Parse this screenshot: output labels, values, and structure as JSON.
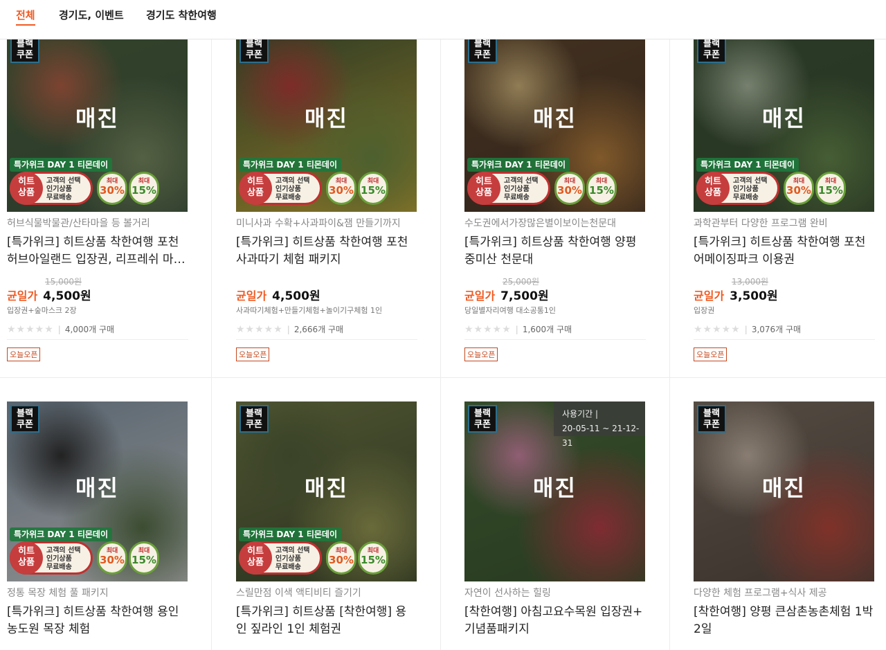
{
  "tabs": [
    "전체",
    "경기도, 이벤트",
    "경기도 착한여행"
  ],
  "soldout_label": "매진",
  "black_coupon_label": [
    "블랙",
    "쿠폰"
  ],
  "banner": {
    "day_label": "특가위크 DAY 1 티몬데이",
    "hit_circle": [
      "히트",
      "상품"
    ],
    "hit_text": [
      "고객의 선택",
      "인기상품",
      "무료배송"
    ],
    "disc1_top": "최대",
    "disc1_val": "30%",
    "disc2_top": "최대",
    "disc2_val": "15%"
  },
  "price_label": "균일가",
  "open_badge": "오늘오픈",
  "star_glyphs": "★★★★★",
  "products": [
    {
      "subtitle": "허브식물박물관/산타마을 등 볼거리",
      "title_lines": [
        "[특가위크] 히트상품 착한여행 포천",
        "허브아일랜드 입장권, 리프레쉬 마…"
      ],
      "original_price": "15,000원",
      "price": "4,500원",
      "option": "입장권+숲마스크 2장",
      "purchases": "4,000개 구매",
      "has_banner": true,
      "colors": [
        "#3d5a2c",
        "#7a8f5a",
        "#c35a3a",
        "#2f4a30"
      ]
    },
    {
      "subtitle": "미니사과 수확+사과파이&잼 만들기까지",
      "title_lines": [
        "[특가위크] 히트상품 착한여행 포천",
        "사과따기 체험 패키지"
      ],
      "original_price": "",
      "price": "4,500원",
      "option": "사과따기체험+만들기체험+놀이기구체험 1인",
      "purchases": "2,666개 구매",
      "has_banner": true,
      "colors": [
        "#2e4a22",
        "#6b8f35",
        "#c4302a",
        "#d9b227"
      ]
    },
    {
      "subtitle": "수도권에서가장많은별이보이는천문대",
      "title_lines": [
        "[특가위크] 히트상품 착한여행 양평",
        "중미산 천문대"
      ],
      "original_price": "25,000원",
      "price": "7,500원",
      "option": "당일별자리여행 대소공통1인",
      "purchases": "1,600개 구매",
      "has_banner": true,
      "colors": [
        "#5a3a1a",
        "#c9822d",
        "#e6c27a",
        "#3a2212"
      ]
    },
    {
      "subtitle": "과학관부터 다양한 프로그램 완비",
      "title_lines": [
        "[특가위크] 히트상품 착한여행 포천",
        "어메이징파크 이용권"
      ],
      "original_price": "13,000원",
      "price": "3,500원",
      "option": "입장권",
      "purchases": "3,076개 구매",
      "has_banner": true,
      "colors": [
        "#2d4a26",
        "#5f8a3f",
        "#b8c9a8",
        "#28401f"
      ]
    },
    {
      "subtitle": "정통 목장 체험 풀 패키지",
      "title_lines": [
        "[특가위크] 히트상품 착한여행 용인",
        "농도원 목장 체험"
      ],
      "has_banner": true,
      "colors": [
        "#7f96aa",
        "#4d6b3a",
        "#1e1e1e",
        "#e8e8e8"
      ]
    },
    {
      "subtitle": "스릴만점 이색 액티비티 즐기기",
      "title_lines": [
        "[특가위크] 히트상품 [착한여행] 용",
        "인 짚라인 1인 체험권"
      ],
      "has_banner": true,
      "colors": [
        "#6f7a3a",
        "#a0a24a",
        "#4a5a2a",
        "#2c3a18"
      ]
    },
    {
      "subtitle": "자연이 선사하는 힐링",
      "title_lines": [
        "[착한여행] 아침고요수목원 입장권+",
        "기념품패키지"
      ],
      "has_banner": false,
      "period": [
        "사용기간 |",
        "20-05-11 ~ 21-12-31"
      ],
      "colors": [
        "#3e6a2a",
        "#c8303a",
        "#e58ab0",
        "#2a4a1c"
      ]
    },
    {
      "subtitle": "다양한 체험 프로그램+식사 제공",
      "title_lines": [
        "[착한여행] 양평 큰삼촌농촌체험 1박",
        "2일"
      ],
      "has_banner": false,
      "colors": [
        "#7a6a5a",
        "#c73a2a",
        "#d9c4b0",
        "#4a3a30"
      ]
    }
  ]
}
